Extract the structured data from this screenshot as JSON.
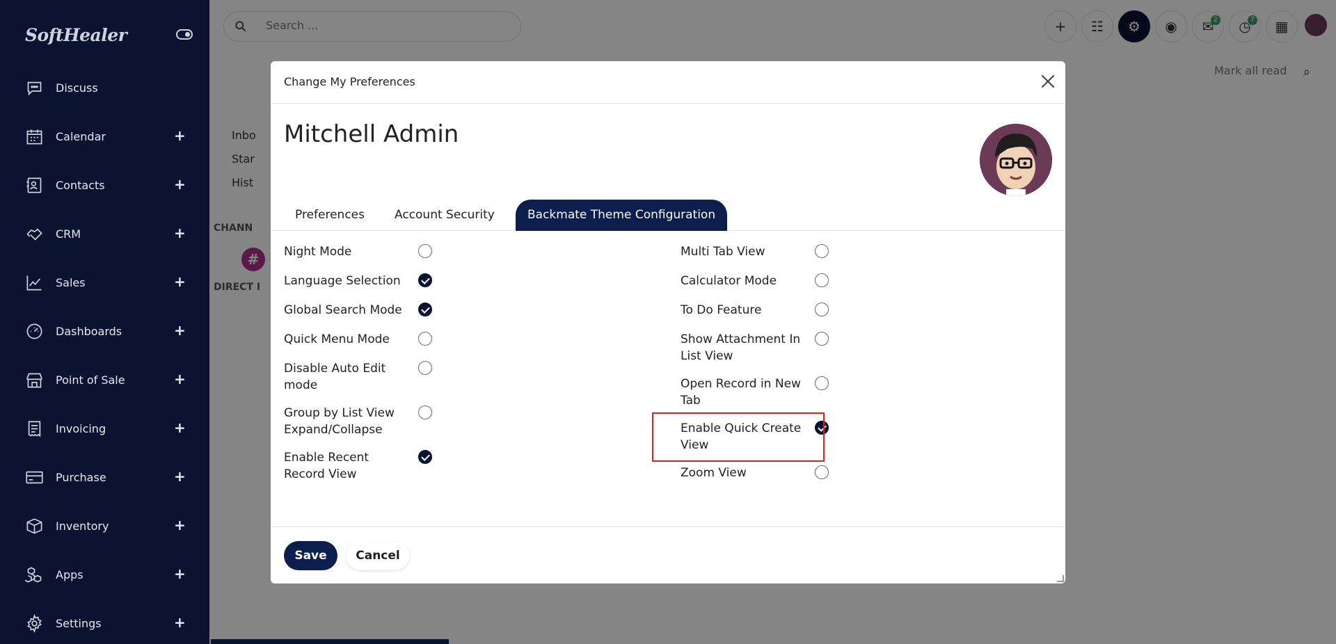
{
  "sidebar": {
    "brand": "SoftHealer",
    "items": [
      {
        "label": "Discuss",
        "icon": "chat-icon",
        "plus": ""
      },
      {
        "label": "Calendar",
        "icon": "calendar-icon",
        "plus": "+"
      },
      {
        "label": "Contacts",
        "icon": "contact-card-icon",
        "plus": "+"
      },
      {
        "label": "CRM",
        "icon": "handshake-icon",
        "plus": "+"
      },
      {
        "label": "Sales",
        "icon": "trend-chart-icon",
        "plus": "+"
      },
      {
        "label": "Dashboards",
        "icon": "gauge-icon",
        "plus": "+"
      },
      {
        "label": "Point of Sale",
        "icon": "store-icon",
        "plus": "+"
      },
      {
        "label": "Invoicing",
        "icon": "receipt-icon",
        "plus": "+"
      },
      {
        "label": "Purchase",
        "icon": "credit-card-icon",
        "plus": "+"
      },
      {
        "label": "Inventory",
        "icon": "box-icon",
        "plus": "+"
      },
      {
        "label": "Apps",
        "icon": "cubes-icon",
        "plus": "+"
      },
      {
        "label": "Settings",
        "icon": "gear-icon",
        "plus": "+"
      }
    ]
  },
  "topbar": {
    "search_placeholder": "Search ...",
    "chat_badge": "2",
    "activity_badge": "7",
    "mark_all_read": "Mark all read"
  },
  "background": {
    "inbox": "Inbo",
    "starred": "Star",
    "history": "Hist",
    "channels": "CHANN",
    "direct": "DIRECT I",
    "hash": "#"
  },
  "modal": {
    "title": "Change My Preferences",
    "user_name": "Mitchell Admin",
    "tabs": [
      "Preferences",
      "Account Security",
      "Backmate Theme Configuration"
    ],
    "active_tab": "Backmate Theme Configuration",
    "left_options": [
      {
        "label": "Night Mode",
        "checked": false
      },
      {
        "label": "Language Selection",
        "checked": true
      },
      {
        "label": "Global Search Mode",
        "checked": true
      },
      {
        "label": "Quick Menu Mode",
        "checked": false
      },
      {
        "label": "Disable Auto Edit mode",
        "checked": false
      },
      {
        "label": "Group by List View Expand/Collapse",
        "checked": false
      },
      {
        "label": "Enable Recent Record View",
        "checked": true
      }
    ],
    "right_options": [
      {
        "label": "Multi Tab View",
        "checked": false
      },
      {
        "label": "Calculator Mode",
        "checked": false
      },
      {
        "label": "To Do Feature",
        "checked": false
      },
      {
        "label": "Show Attachment In List View",
        "checked": false
      },
      {
        "label": "Open Record in New Tab",
        "checked": false
      },
      {
        "label": "Enable Quick Create View",
        "checked": true
      },
      {
        "label": "Zoom View",
        "checked": false
      }
    ],
    "save_label": "Save",
    "cancel_label": "Cancel"
  },
  "colors": {
    "sidebar_bg": "#0c1330",
    "accent": "#0c1e4b",
    "highlight": "#e02020"
  }
}
